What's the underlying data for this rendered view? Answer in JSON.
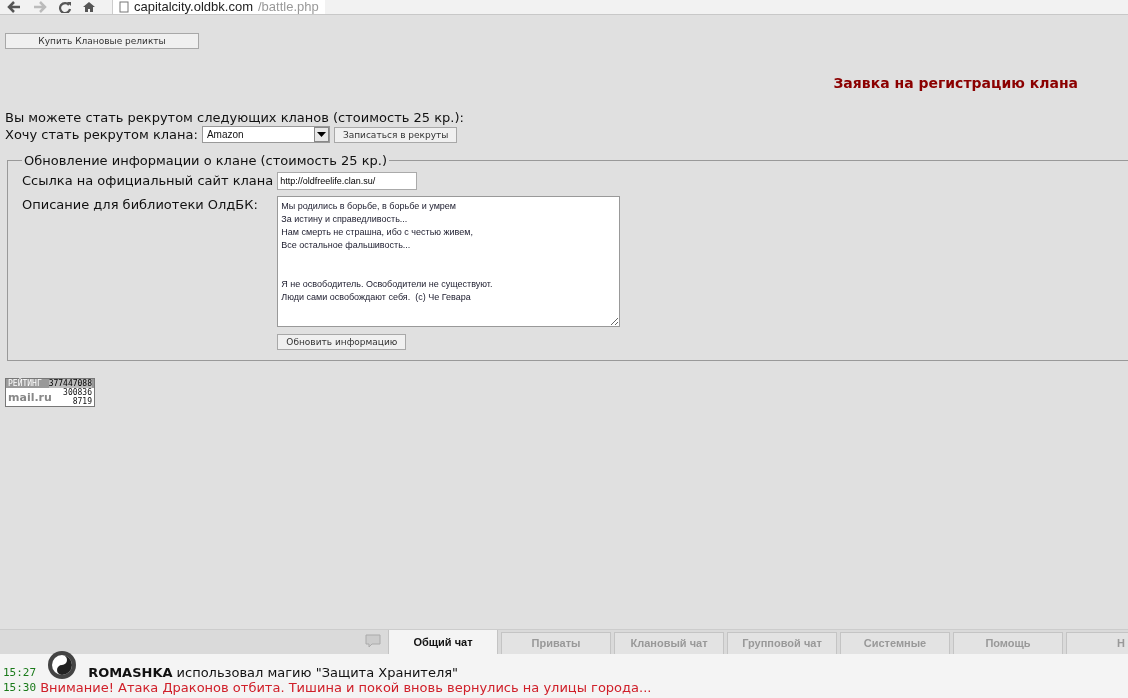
{
  "browser": {
    "address_host": "capitalcity.oldbk.com",
    "address_path": "/battle.php"
  },
  "relics_button": "Купить Клановые реликты",
  "heading": "Заявка на регистрацию клана",
  "recruit": {
    "intro": "Вы можете стать рекрутом следующих кланов (стоимость 25 кр.):",
    "label": "Хочу стать рекрутом клана:",
    "clan": "Amazon",
    "button": "Записаться в рекруты"
  },
  "update": {
    "legend": "Обновление информации о клане (стоимость 25 кр.)",
    "site_label": "Ссылка на официальный сайт клана",
    "site_value": "http://oldfreelife.clan.su/",
    "description_label": "Описание для библиотеки ОлдБК:",
    "description": "Мы родились в борьбе, в борьбе и умрем\nЗа истину и справедливость...\nНам смерть не страшна, ибо с честью живем,\nВсе остальное фальшивость...\n\n\nЯ не освободитель. Освободители не существуют.\nЛюди сами освобождают себя.  (c) Че Гевара",
    "button": "Обновить информацию"
  },
  "counter": {
    "label": "РЕЙТИНГ",
    "total": "377447088",
    "logo": "mail.ru",
    "hits": "300836",
    "hosts": "8719"
  },
  "chat_tabs": [
    {
      "label": "Общий чат",
      "selected": true
    },
    {
      "label": "Приваты",
      "selected": false
    },
    {
      "label": "Клановый чат",
      "selected": false
    },
    {
      "label": "Групповой чат",
      "selected": false
    },
    {
      "label": "Системные",
      "selected": false
    },
    {
      "label": "Помощь",
      "selected": false
    },
    {
      "label": "Н",
      "selected": false
    }
  ],
  "chat_messages": [
    {
      "time": "15:27",
      "kind": "magic",
      "user": "ROMASHKA",
      "text": "использовал магию \"Защита Хранителя\""
    },
    {
      "time": "15:30",
      "kind": "alert",
      "text": "Внимание! Атака Драконов отбита. Тишина и покой вновь вернулись на улицы города..."
    }
  ]
}
